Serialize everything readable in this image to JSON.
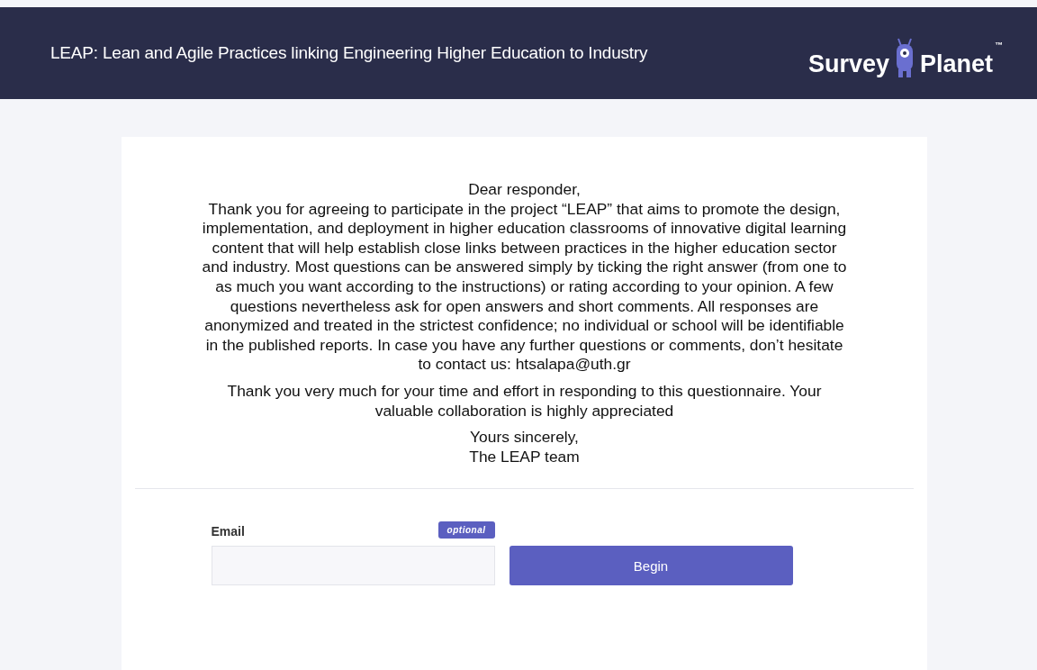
{
  "header": {
    "title": "LEAP: Lean and Agile Practices linking Engineering Higher Education to Industry",
    "logo": {
      "left": "Survey",
      "right": "Planet",
      "mark": "™"
    }
  },
  "intro": {
    "greeting": "Dear responder,",
    "body": "Thank you for agreeing to participate in the project “LEAP” that aims to promote the design, implementation, and deployment in higher education classrooms of innovative digital learning content that will help establish close links between practices in the higher education sector and industry. Most questions can be answered simply by ticking the right answer (from one to as much you want according to the instructions) or rating according to your opinion. A few questions nevertheless ask for open answers and short comments. All responses are anonymized and treated in the strictest confidence; no individual or school will be identifiable in the published reports. In case you have any further questions or comments, don’t hesitate to contact us: htsalapa@uth.gr",
    "thanks": "Thank you very much for your time and effort in responding to this questionnaire. Your valuable collaboration is highly appreciated",
    "closing": [
      "Yours sincerely,",
      "The LEAP team"
    ]
  },
  "form": {
    "email_label": "Email",
    "badge": "optional",
    "begin_button": "Begin"
  }
}
